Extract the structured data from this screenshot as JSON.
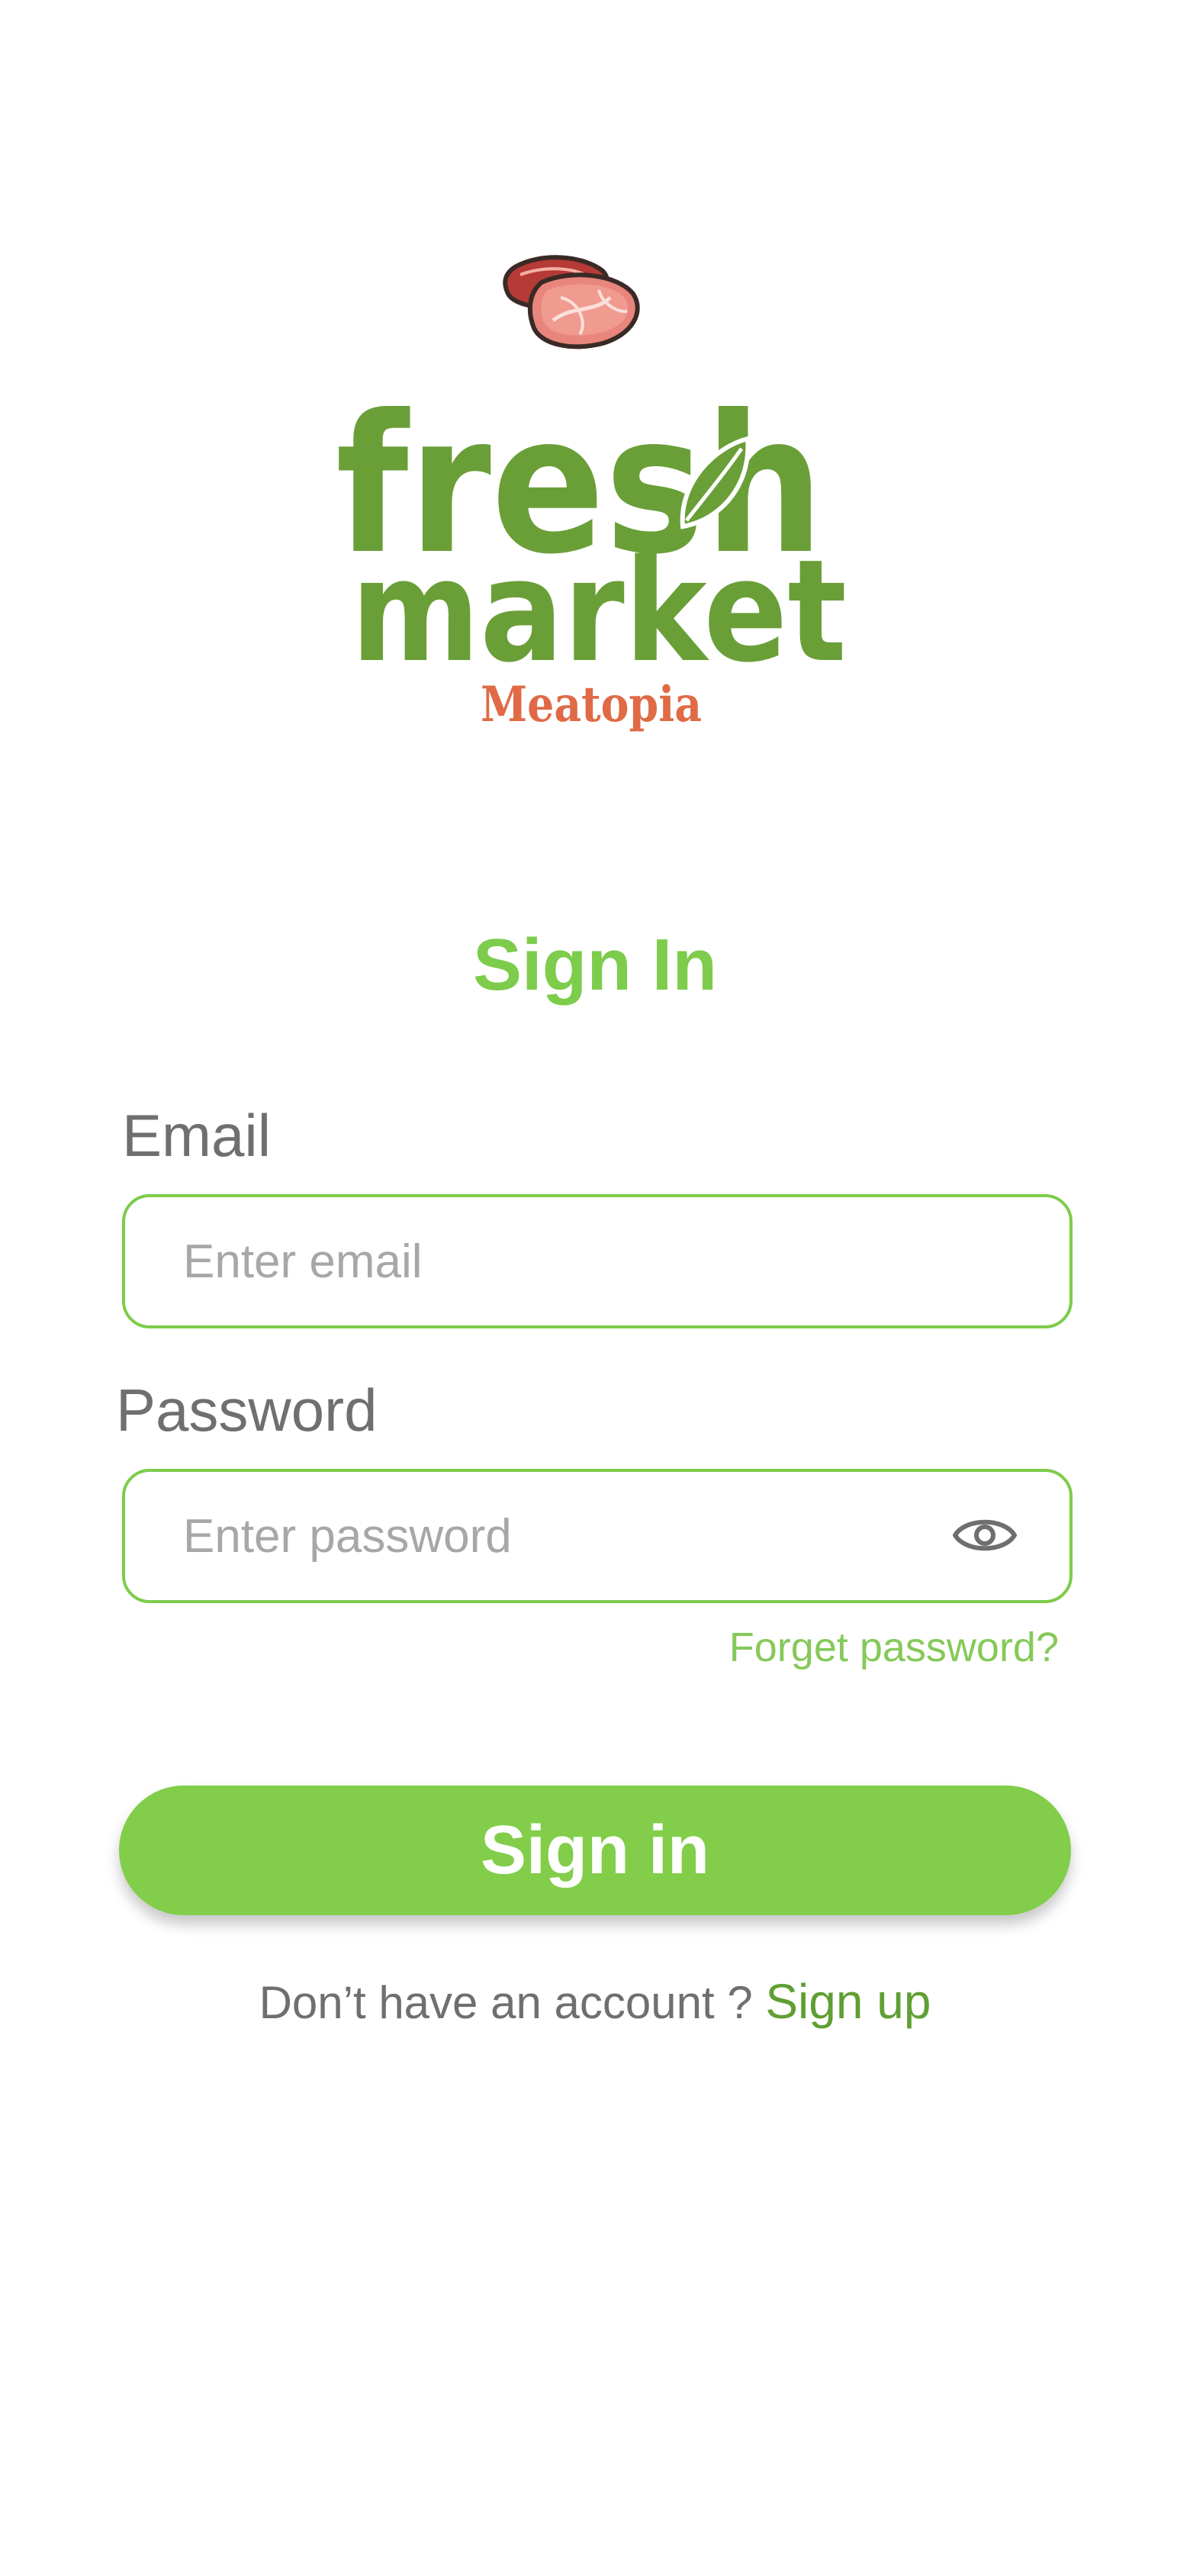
{
  "brand": {
    "logo_line1": "fresh",
    "logo_line2": "market",
    "logo_sub": "Meatopia",
    "colors": {
      "green_dark": "#6a9f38",
      "green_accent": "#7dcc4b",
      "meat_red": "#c9453f",
      "sub_orange": "#e06a46"
    }
  },
  "signin": {
    "title": "Sign In",
    "email_label": "Email",
    "email_placeholder": "Enter email",
    "email_value": "",
    "password_label": "Password",
    "password_placeholder": "Enter password",
    "password_value": "",
    "password_toggle_icon": "eye-icon",
    "forgot_label": "Forget password?",
    "button_label": "Sign in",
    "no_account_text": "Don’t have an account ?",
    "signup_label": "Sign up"
  }
}
